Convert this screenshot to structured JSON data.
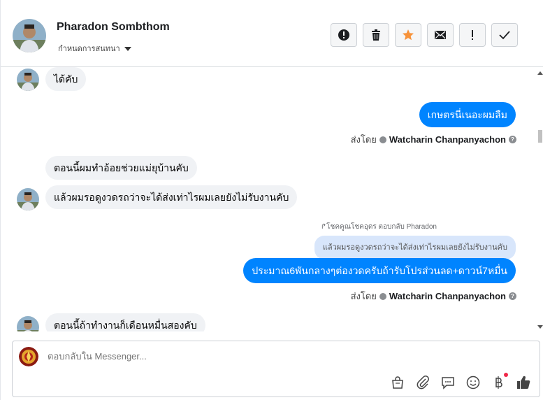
{
  "header": {
    "contact_name": "Pharadon Sombthom",
    "label_selector": "กำหนดการสนทนา",
    "actions": [
      {
        "name": "alert-icon",
        "label": "important"
      },
      {
        "name": "trash-icon",
        "label": "delete"
      },
      {
        "name": "star-icon",
        "label": "star"
      },
      {
        "name": "mail-icon",
        "label": "mark unread"
      },
      {
        "name": "exclamation-icon",
        "label": "spam"
      },
      {
        "name": "check-icon",
        "label": "done"
      }
    ]
  },
  "messages": {
    "m1": "ได้คับ",
    "m2": "เกษตรนี่เนอะผมลืม",
    "m3": "ตอนนี้ผมทำอ้อยช่วยแม่ยุบ้านคับ",
    "m4": "แล้วผมรอดูงวดรถว่าจะได้ส่งเท่าไรผมเลยยังไม่รับงานคับ",
    "reply_note": "โชคคูณโชคอุดร ตอบกลับ Pharadon",
    "quoted": "แล้วผมรอดูงวดรถว่าจะได้ส่งเท่าไรผมเลยยังไม่รับงานคับ",
    "m5": "ประมาณ6พันกลางๆต่องวดครับถ้ารับโปรส่วนลด+ดาวน์7หมื่น",
    "m6": "ตอนนี้ถ้าทำงานก็เดือนหมื่นสองคับ",
    "sent_by_prefix": "ส่งโดย",
    "sent_by_name": "Watcharin Chanpanyachon"
  },
  "composer": {
    "placeholder": "ตอบกลับใน Messenger..."
  },
  "colors": {
    "outgoing": "#0084ff",
    "incoming": "#f0f2f5",
    "quote": "#d8e6fb",
    "star": "#f7923a"
  }
}
